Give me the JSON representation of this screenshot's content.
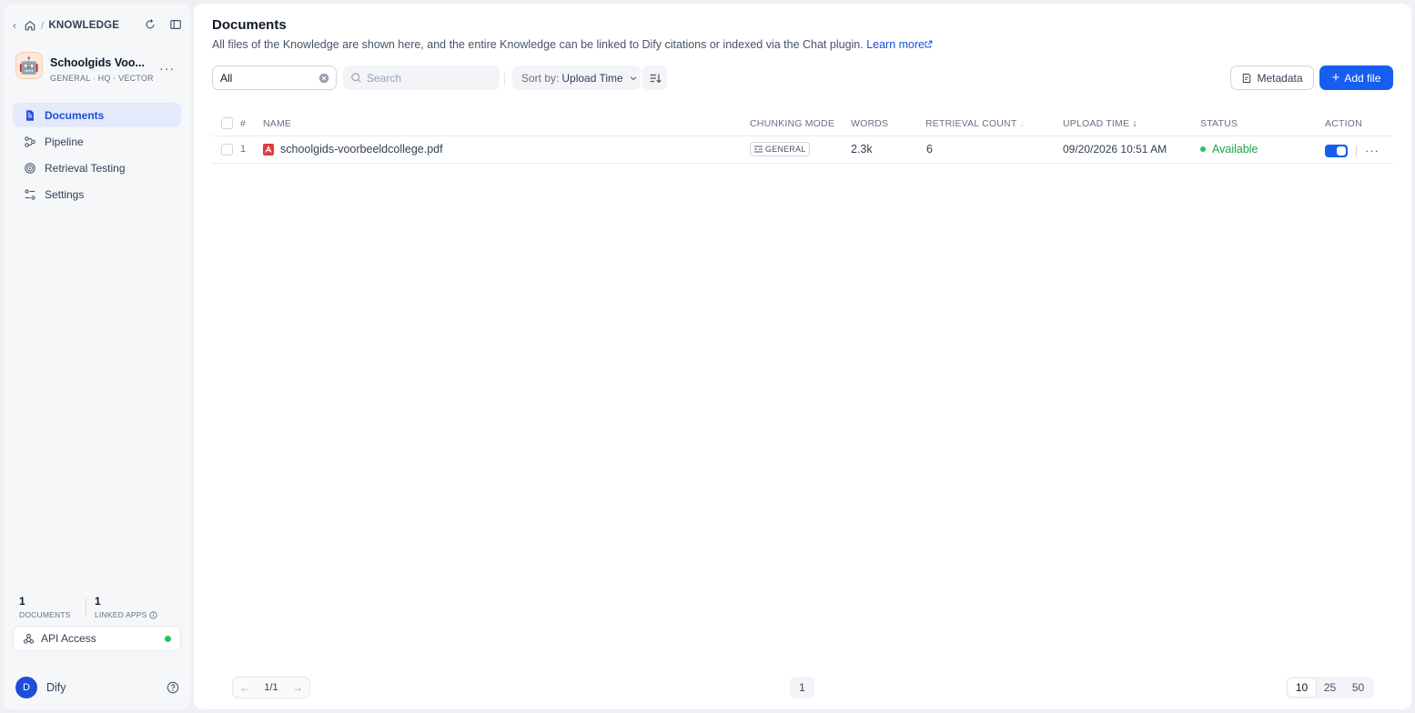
{
  "breadcrumb": {
    "root_label": "KNOWLEDGE"
  },
  "knowledge": {
    "name": "Schoolgids Voo...",
    "meta": "GENERAL · HQ · VECTOR",
    "avatar_emoji": "🤖"
  },
  "nav": {
    "items": [
      {
        "label": "Documents",
        "icon": "document-icon",
        "active": true
      },
      {
        "label": "Pipeline",
        "icon": "pipeline-icon",
        "active": false
      },
      {
        "label": "Retrieval Testing",
        "icon": "target-icon",
        "active": false
      },
      {
        "label": "Settings",
        "icon": "settings-icon",
        "active": false
      }
    ]
  },
  "stats": {
    "documents_count": "1",
    "documents_label": "DOCUMENTS",
    "linked_apps_count": "1",
    "linked_apps_label": "LINKED APPS"
  },
  "api": {
    "label": "API Access",
    "status_color": "#22c55e"
  },
  "user": {
    "initial": "D",
    "name": "Dify"
  },
  "page": {
    "title": "Documents",
    "description": "All files of the Knowledge are shown here, and the entire Knowledge can be linked to Dify citations or indexed via the Chat plugin.",
    "learn_more": "Learn more"
  },
  "toolbar": {
    "filter_value": "All",
    "search_placeholder": "Search",
    "sort_prefix": "Sort by:",
    "sort_value": "Upload Time",
    "metadata_label": "Metadata",
    "add_file_label": "Add file"
  },
  "table": {
    "headers": {
      "index": "#",
      "name": "NAME",
      "chunking_mode": "CHUNKING MODE",
      "words": "WORDS",
      "retrieval_count": "RETRIEVAL COUNT",
      "upload_time": "UPLOAD TIME",
      "status": "STATUS",
      "action": "ACTION"
    },
    "rows": [
      {
        "index": "1",
        "name": "schoolgids-voorbeeldcollege.pdf",
        "chunking_mode": "GENERAL",
        "words": "2.3k",
        "retrieval_count": "6",
        "upload_time": "09/20/2026 10:51 AM",
        "status": "Available",
        "enabled": true
      }
    ]
  },
  "pagination": {
    "page_indicator": "1/1",
    "current_page": "1",
    "page_sizes": [
      "10",
      "25",
      "50"
    ],
    "active_page_size": "10"
  },
  "colors": {
    "accent": "#155eef",
    "active_nav_bg": "#e4eafb",
    "status_available": "#17a34a"
  }
}
